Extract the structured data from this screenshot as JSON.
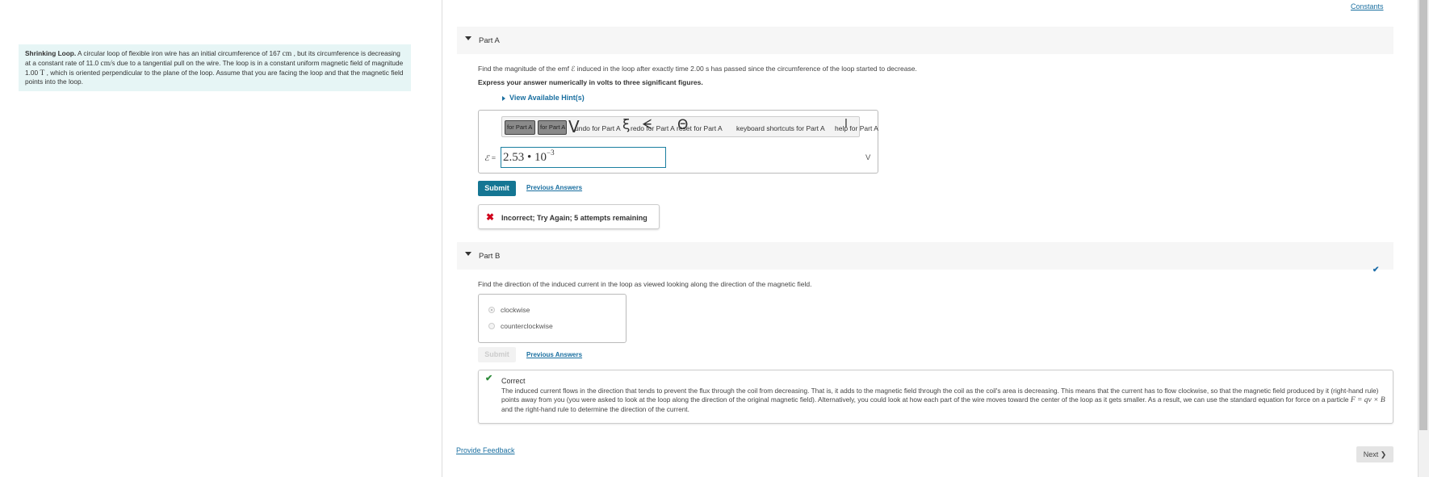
{
  "problem": {
    "title": "Shrinking Loop.",
    "text_1": " A circular loop of flexible iron wire has an initial circumference of 167 ",
    "unit_cm": "cm",
    "text_2": " , but its circumference is decreasing at a constant rate of 11.0 ",
    "unit_rate": "cm/s",
    "text_3": " due to a tangential pull on the wire. The loop is in a constant uniform magnetic field of magnitude 1.00 ",
    "unit_t": "T",
    "text_4": " , which is oriented perpendicular to the plane of the loop. Assume that you are facing the loop and that the magnetic field points into the loop."
  },
  "constants_link": "Constants",
  "part_a": {
    "title": "Part A",
    "question": "Find the magnitude of the emf ℰ induced in the loop after exactly time 2.00 s has passed since the circumference of the loop started to decrease.",
    "instruction": "Express your answer numerically in volts to three significant figures.",
    "hint_link": "View Available Hint(s)",
    "toolbar": {
      "btn1": "for Part A",
      "btn2": "for Part A",
      "undo": "undo for Part A",
      "redo": "redo for Part A",
      "reset": "reset for Part A",
      "shortcuts": "keyboard shortcuts for Part A",
      "help": "help for Part A"
    },
    "eq_label": "ℰ =",
    "answer_base": "2.53 • 10",
    "answer_exp": "−3",
    "unit": "V",
    "submit": "Submit",
    "previous_answers": "Previous Answers",
    "feedback": "Incorrect; Try Again; 5 attempts remaining"
  },
  "part_b": {
    "title": "Part B",
    "question": "Find the direction of the induced current in the loop as viewed looking along the direction of the magnetic field.",
    "options": [
      "clockwise",
      "counterclockwise"
    ],
    "selected": "clockwise",
    "submit": "Submit",
    "previous_answers": "Previous Answers",
    "feedback_title": "Correct",
    "feedback_body_1": "The induced current flows in the direction that tends to prevent the flux through the coil from decreasing. That is, it adds to the magnetic field through the coil as the coil's area is decreasing. This means that the current has to flow clockwise, so that the magnetic field produced by it (right-hand rule) points away from you (you were asked to look at the loop along the direction of the original magnetic field). Alternatively, you could look at how each part of the wire moves toward the center of the loop as it gets smaller. As a result, we can use the standard equation for force on a particle ",
    "feedback_formula": "F = qv × B",
    "feedback_body_2": " and the right-hand rule to determine the direction of the current."
  },
  "footer": {
    "provide_feedback": "Provide Feedback",
    "next": "Next ❯"
  },
  "colors": {
    "accent": "#157693",
    "link": "#1a6fa0",
    "problem_bg": "#e6f5f5",
    "error": "#d0021b",
    "success": "#2e8b3a"
  }
}
